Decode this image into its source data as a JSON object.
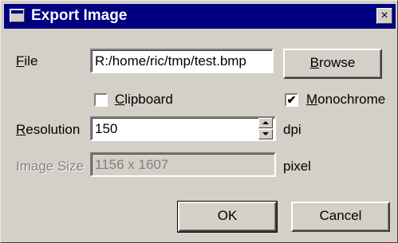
{
  "dialog": {
    "title": "Export Image",
    "close_symbol": "×",
    "icon": "window-icon"
  },
  "file": {
    "label": "File",
    "label_underline": "F",
    "label_rest": "ile",
    "value": "R:/home/ric/tmp/test.bmp",
    "browse_underline": "B",
    "browse_rest": "rowse"
  },
  "clipboard": {
    "underline": "C",
    "rest": "lipboard",
    "checked": false
  },
  "monochrome": {
    "underline": "M",
    "rest": "onochrome",
    "checked": true,
    "check_mark": "✔"
  },
  "resolution": {
    "underline": "R",
    "rest": "esolution",
    "value": "150",
    "unit": "dpi"
  },
  "image_size": {
    "label": "Image Size",
    "value": "1156 x 1607",
    "unit": "pixel"
  },
  "buttons": {
    "ok": "OK",
    "cancel": "Cancel"
  }
}
